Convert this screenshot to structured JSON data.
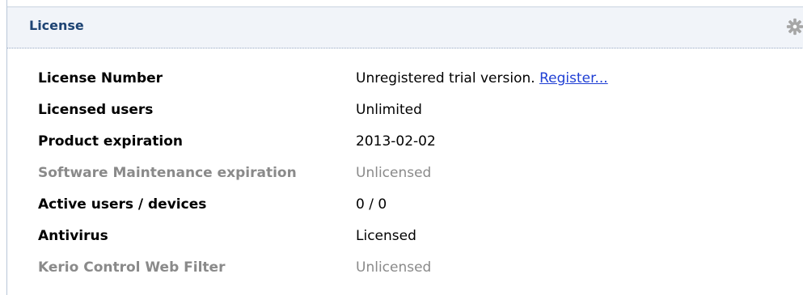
{
  "panel": {
    "title": "License"
  },
  "rows": [
    {
      "label": "License Number",
      "value": "Unregistered trial version.",
      "link": "Register..."
    },
    {
      "label": "Licensed users",
      "value": "Unlimited"
    },
    {
      "label": "Product expiration",
      "value": "2013-02-02"
    },
    {
      "label": "Software Maintenance expiration",
      "value": "Unlicensed",
      "state": "disabled"
    },
    {
      "label": "Active users / devices",
      "value": "0 / 0"
    },
    {
      "label": "Antivirus",
      "value": "Licensed"
    },
    {
      "label": "Kerio Control Web Filter",
      "value": "Unlicensed",
      "state": "disabled"
    }
  ],
  "icons": {
    "settings": "gear-icon"
  },
  "colors": {
    "header_background": "#f1f4f9",
    "title": "#1d4373",
    "link": "#1f3fd4",
    "disabled_text": "#8a8a8a"
  }
}
